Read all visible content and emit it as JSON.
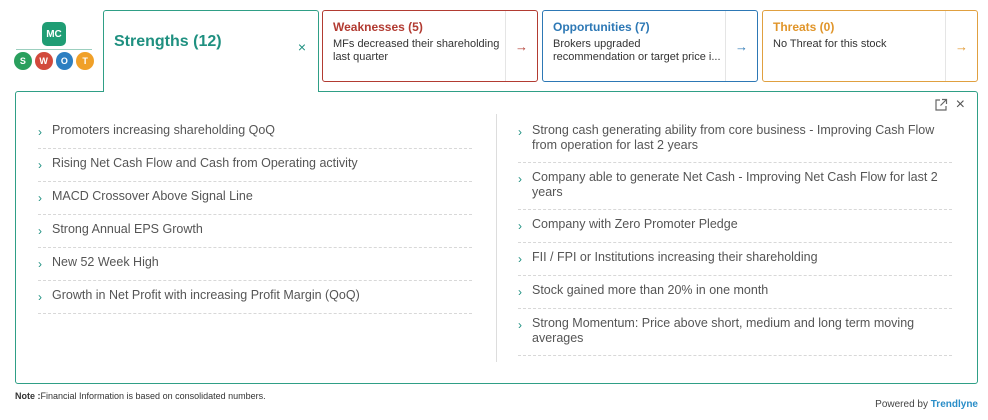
{
  "logo": {
    "mc": "MC",
    "letters": [
      "S",
      "W",
      "O",
      "T"
    ],
    "colors": [
      "#2a9f5d",
      "#d2493c",
      "#2d7fc1",
      "#f0a028"
    ]
  },
  "tabs": {
    "strengths": {
      "title": "Strengths (12)",
      "close": "×",
      "color": "#1f9080"
    },
    "weaknesses": {
      "title": "Weaknesses (5)",
      "text": "MFs decreased their shareholding last quarter",
      "arrow": "→",
      "color": "#b23b32"
    },
    "opportunities": {
      "title": "Opportunities (7)",
      "text": "Brokers upgraded recommendation or target price i...",
      "arrow": "→",
      "color": "#2d78b5"
    },
    "threats": {
      "title": "Threats (0)",
      "text": "No Threat for this stock",
      "arrow": "→",
      "color": "#e0952a"
    }
  },
  "panel": {
    "close": "×",
    "left_items": [
      "Promoters increasing shareholding QoQ",
      "Rising Net Cash Flow and Cash from Operating activity",
      "MACD Crossover Above Signal Line",
      "Strong Annual EPS Growth",
      "New 52 Week High",
      "Growth in Net Profit with increasing Profit Margin (QoQ)"
    ],
    "right_items": [
      "Strong cash generating ability from core business - Improving Cash Flow from operation for last 2 years",
      "Company able to generate Net Cash - Improving Net Cash Flow for last 2 years",
      "Company with Zero Promoter Pledge",
      "FII / FPI or Institutions increasing their shareholding",
      "Stock gained more than 20% in one month",
      "Strong Momentum: Price above short, medium and long term moving averages"
    ]
  },
  "footer": {
    "note_label": "Note :",
    "note_text": "Financial Information is based on consolidated numbers.",
    "powered_by": "Powered by",
    "brand": "Trendlyne"
  }
}
